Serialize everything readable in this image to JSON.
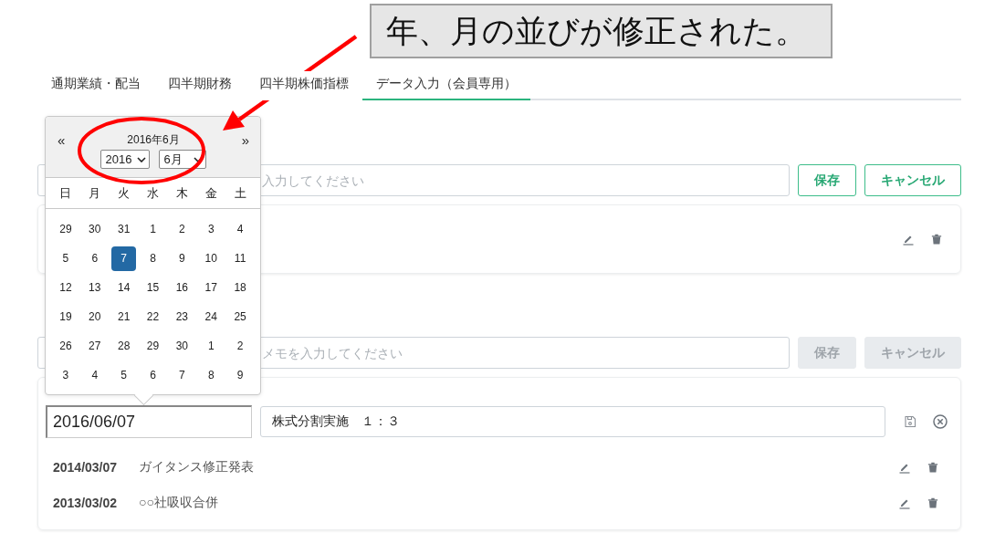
{
  "annotation": {
    "text": "年、月の並びが修正された。"
  },
  "tabs": [
    {
      "label": "通期業績・配当",
      "selected": false
    },
    {
      "label": "四半期財務",
      "selected": false
    },
    {
      "label": "四半期株価指標",
      "selected": false
    },
    {
      "label": "データ入力（会員専用）",
      "selected": true
    }
  ],
  "sections": [
    {
      "memo_placeholder": "入力してください",
      "buttons": [
        {
          "label": "保存",
          "disabled": false
        },
        {
          "label": "キャンセル",
          "disabled": false
        }
      ],
      "entries": [
        {
          "kind": "row"
        }
      ]
    },
    {
      "memo_placeholder": "メモを入力してください",
      "buttons": [
        {
          "label": "保存",
          "disabled": true
        },
        {
          "label": "キャンセル",
          "disabled": true
        }
      ],
      "entries": [
        {
          "kind": "editing",
          "date": "2016/06/07",
          "memo": "株式分割実施　１：３"
        },
        {
          "kind": "row",
          "date": "2014/03/07",
          "memo": "ガイタンス修正発表"
        },
        {
          "kind": "row",
          "date": "2013/03/02",
          "memo": "○○社吸収合併"
        }
      ]
    }
  ],
  "calendar": {
    "prev": "«",
    "next": "»",
    "title": "2016年6月",
    "year_select": "2016",
    "month_select": "6月",
    "weekdays": [
      "日",
      "月",
      "火",
      "水",
      "木",
      "金",
      "土"
    ],
    "weeks": [
      [
        {
          "day": "29",
          "selected": false
        },
        {
          "day": "30",
          "selected": false
        },
        {
          "day": "31",
          "selected": false
        },
        {
          "day": "1",
          "selected": false
        },
        {
          "day": "2",
          "selected": false
        },
        {
          "day": "3",
          "selected": false
        },
        {
          "day": "4",
          "selected": false
        }
      ],
      [
        {
          "day": "5",
          "selected": false
        },
        {
          "day": "6",
          "selected": false
        },
        {
          "day": "7",
          "selected": true
        },
        {
          "day": "8",
          "selected": false
        },
        {
          "day": "9",
          "selected": false
        },
        {
          "day": "10",
          "selected": false
        },
        {
          "day": "11",
          "selected": false
        }
      ],
      [
        {
          "day": "12",
          "selected": false
        },
        {
          "day": "13",
          "selected": false
        },
        {
          "day": "14",
          "selected": false
        },
        {
          "day": "15",
          "selected": false
        },
        {
          "day": "16",
          "selected": false
        },
        {
          "day": "17",
          "selected": false
        },
        {
          "day": "18",
          "selected": false
        }
      ],
      [
        {
          "day": "19",
          "selected": false
        },
        {
          "day": "20",
          "selected": false
        },
        {
          "day": "21",
          "selected": false
        },
        {
          "day": "22",
          "selected": false
        },
        {
          "day": "23",
          "selected": false
        },
        {
          "day": "24",
          "selected": false
        },
        {
          "day": "25",
          "selected": false
        }
      ],
      [
        {
          "day": "26",
          "selected": false
        },
        {
          "day": "27",
          "selected": false
        },
        {
          "day": "28",
          "selected": false
        },
        {
          "day": "29",
          "selected": false
        },
        {
          "day": "30",
          "selected": false
        },
        {
          "day": "1",
          "selected": false
        },
        {
          "day": "2",
          "selected": false
        }
      ],
      [
        {
          "day": "3",
          "selected": false
        },
        {
          "day": "4",
          "selected": false
        },
        {
          "day": "5",
          "selected": false
        },
        {
          "day": "6",
          "selected": false
        },
        {
          "day": "7",
          "selected": false
        },
        {
          "day": "8",
          "selected": false
        },
        {
          "day": "9",
          "selected": false
        }
      ]
    ]
  }
}
